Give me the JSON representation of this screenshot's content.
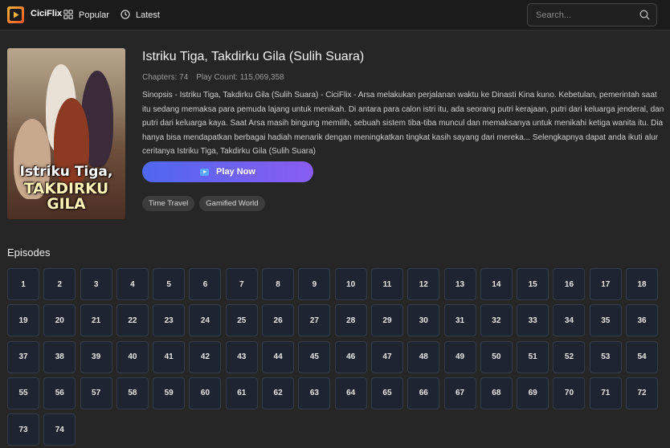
{
  "header": {
    "logo_text": "CiciFlix",
    "nav": [
      {
        "label": "Popular",
        "icon": "grid-icon"
      },
      {
        "label": "Latest",
        "icon": "clock-icon"
      }
    ],
    "search": {
      "placeholder": "Search...",
      "icon": "search-icon"
    }
  },
  "drama": {
    "title": "Istriku Tiga, Takdirku Gila (Sulih Suara)",
    "chapters": "Chapters: 74",
    "play_count": "Play Count: 115,069,358",
    "synopsis": "Sinopsis - Istriku Tiga, Takdirku Gila (Sulih Suara) - CiciFlix - Arsa melakukan perjalanan waktu ke Dinasti Kina kuno. Kebetulan, pemerintah saat itu sedang memaksa para pemuda lajang untuk menikah. Di antara para calon istri itu, ada seorang putri kerajaan, putri dari keluarga jenderal, dan putri dari keluarga kaya. Saat Arsa masih bingung memilih, sebuah sistem tiba-tiba muncul dan memaksanya untuk menikahi ketiga wanita itu. Dia hanya bisa mendapatkan berbagai hadiah menarik dengan meningkatkan tingkat kasih sayang dari mereka... Selengkapnya dapat anda ikuti alur ceritanya Istriku Tiga, Takdirku Gila (Sulih Suara)",
    "play_label": "Play Now",
    "tags": [
      "Time Travel",
      "Gamified World"
    ],
    "poster": {
      "line1": "Istriku Tiga,",
      "line2": "TAKDIRKU GILA"
    }
  },
  "episodes": {
    "heading": "Episodes",
    "items": [
      "1",
      "2",
      "3",
      "4",
      "5",
      "6",
      "7",
      "8",
      "9",
      "10",
      "11",
      "12",
      "13",
      "14",
      "15",
      "16",
      "17",
      "18",
      "19",
      "20",
      "21",
      "22",
      "23",
      "24",
      "25",
      "26",
      "27",
      "28",
      "29",
      "30",
      "31",
      "32",
      "33",
      "34",
      "35",
      "36",
      "37",
      "38",
      "39",
      "40",
      "41",
      "42",
      "43",
      "44",
      "45",
      "46",
      "47",
      "48",
      "49",
      "50",
      "51",
      "52",
      "53",
      "54",
      "55",
      "56",
      "57",
      "58",
      "59",
      "60",
      "61",
      "62",
      "63",
      "64",
      "65",
      "66",
      "67",
      "68",
      "69",
      "70",
      "71",
      "72",
      "73",
      "74"
    ]
  },
  "colors": {
    "accent_start": "#4f67f0",
    "accent_end": "#8a5df2",
    "background": "#262626",
    "episode_tile": "#1e2430"
  }
}
